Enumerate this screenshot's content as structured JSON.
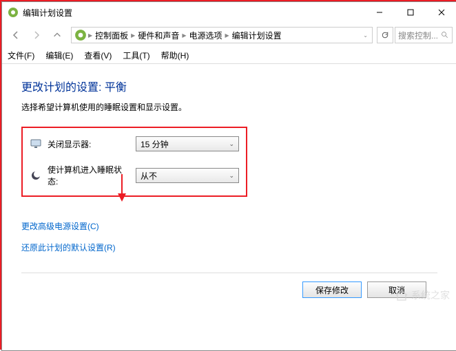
{
  "window": {
    "title": "编辑计划设置"
  },
  "titlebar_buttons": {
    "min": "–",
    "max": "□",
    "close": "✕"
  },
  "breadcrumb": {
    "parts": [
      "控制面板",
      "硬件和声音",
      "电源选项",
      "编辑计划设置"
    ]
  },
  "search": {
    "placeholder": "搜索控制..."
  },
  "menu": {
    "file": "文件(F)",
    "edit": "编辑(E)",
    "view": "查看(V)",
    "tools": "工具(T)",
    "help": "帮助(H)"
  },
  "page": {
    "heading": "更改计划的设置: 平衡",
    "subtext": "选择希望计算机使用的睡眠设置和显示设置。"
  },
  "settings": {
    "display_off": {
      "label": "关闭显示器:",
      "value": "15 分钟"
    },
    "sleep": {
      "label": "使计算机进入睡眠状态:",
      "value": "从不"
    }
  },
  "links": {
    "advanced": "更改高级电源设置(C)",
    "restore": "还原此计划的默认设置(R)"
  },
  "buttons": {
    "save": "保存修改",
    "cancel": "取消"
  },
  "watermark": "系统之家"
}
